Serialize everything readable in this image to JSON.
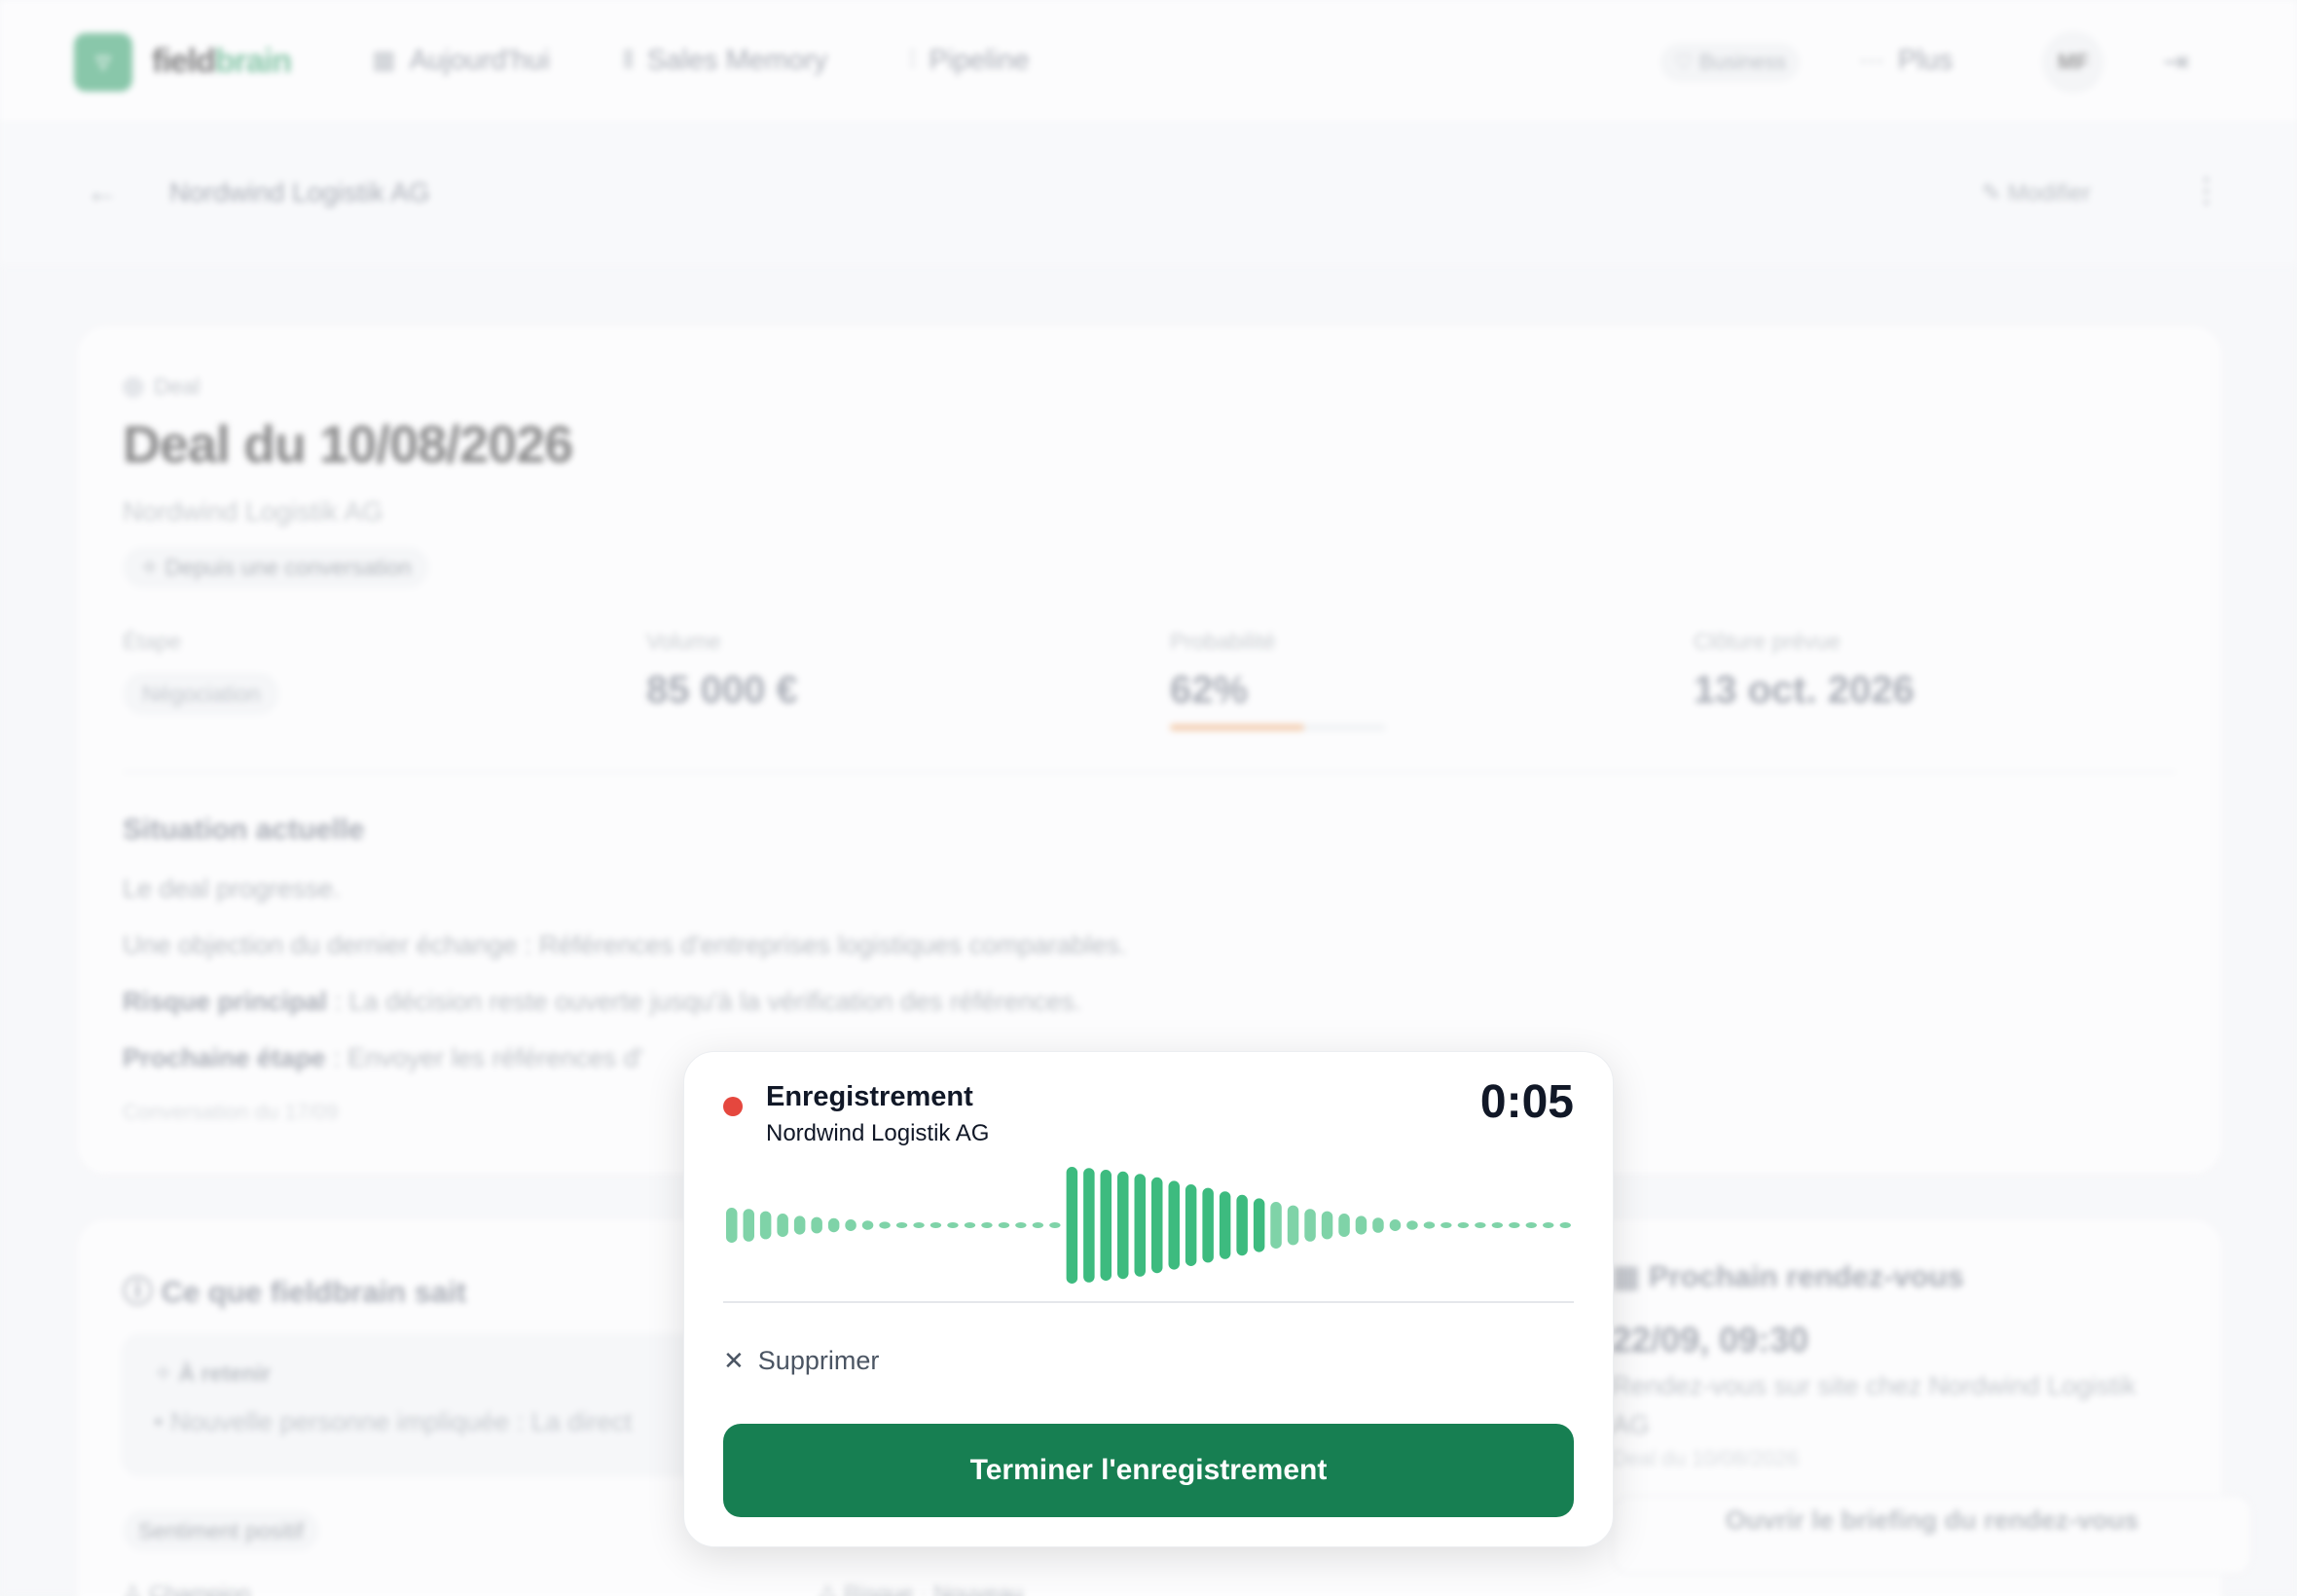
{
  "nav": {
    "brand_prefix": "field",
    "brand_suffix": "brain",
    "items": [
      {
        "label": "Aujourd'hui",
        "icon": "calendar-icon"
      },
      {
        "label": "Sales Memory",
        "icon": "library-icon"
      },
      {
        "label": "Pipeline",
        "icon": "pipeline-icon"
      }
    ],
    "plan_badge": "Business",
    "more_label": "Plus",
    "avatar_initials": "MF"
  },
  "subbar": {
    "title": "Nordwind Logistik AG",
    "modify_label": "Modifier"
  },
  "deal": {
    "tag": "Deal",
    "title": "Deal du 10/08/2026",
    "company": "Nordwind Logistik AG",
    "source_chip": "Depuis une conversation",
    "stats": {
      "stage_label": "Étape",
      "stage_value": "Négociation",
      "volume_label": "Volume",
      "volume_value": "85 000 €",
      "probability_label": "Probabilité",
      "probability_value": "62%",
      "probability_fraction": 0.62,
      "close_label": "Clôture prévue",
      "close_value": "13 oct. 2026"
    },
    "situation": {
      "title": "Situation actuelle",
      "line1": "Le deal progresse.",
      "line2": "Une objection du dernier échange : Références d'entreprises logistiques comparables.",
      "risk_label": "Risque principal",
      "risk_text": " : La décision reste ouverte jusqu'à la vérification des références.",
      "next_label": "Prochaine étape",
      "next_text": " : Envoyer les références d'",
      "source": "Conversation du 17/09"
    }
  },
  "knows": {
    "title": "Ce que fieldbrain sait",
    "box_label": "À retenir",
    "box_text": "• Nouvelle personne impliquée : La direct",
    "sentiment": "Sentiment positif",
    "champion": "Champion",
    "risk": "Risque · Nouveau"
  },
  "next_meeting": {
    "title": "Prochain rendez-vous",
    "date": "22/09, 09:30",
    "description": "Rendez-vous sur site chez Nordwind Logistik AG",
    "sub": "Deal du 10/08/2026",
    "briefing": "Ouvrir le briefing du rendez-vous"
  },
  "recording": {
    "title": "Enregistrement",
    "company": "Nordwind Logistik AG",
    "timer": "0:05",
    "delete_label": "Supprimer",
    "finish_label": "Terminer l'enregistrement",
    "colors": {
      "wave": "#3dbb7f",
      "wave_light": "#7fd3a8",
      "button": "#177f52",
      "dot": "#e5473e"
    },
    "levels": [
      0.3,
      0.28,
      0.24,
      0.2,
      0.16,
      0.14,
      0.12,
      0.1,
      0.08,
      0.06,
      0.05,
      0.04,
      0.03,
      0.02,
      0.02,
      0.02,
      0.02,
      0.02,
      0.02,
      0.02,
      1.0,
      0.98,
      0.95,
      0.92,
      0.88,
      0.82,
      0.76,
      0.7,
      0.64,
      0.58,
      0.52,
      0.46,
      0.4,
      0.34,
      0.28,
      0.24,
      0.2,
      0.16,
      0.13,
      0.1,
      0.08,
      0.06,
      0.05,
      0.04,
      0.03,
      0.02,
      0.02,
      0.02,
      0.02,
      0.02
    ]
  }
}
